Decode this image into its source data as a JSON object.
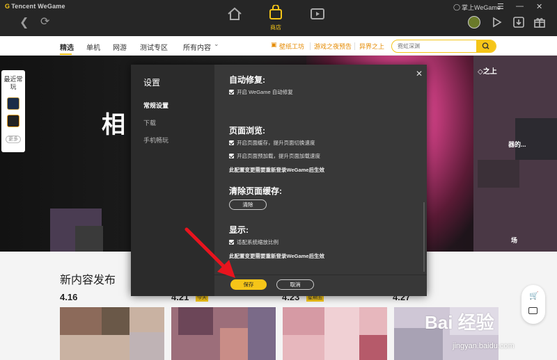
{
  "app": {
    "logo_text": "Tencent WeGame",
    "store_label": "商店",
    "user_label": "掌上WeGame"
  },
  "subnav": {
    "items": [
      "精选",
      "单机",
      "网游",
      "测试专区",
      "所有内容"
    ],
    "links": [
      "壁纸工坊",
      "游戏之夜预告",
      "异界之上"
    ],
    "search_placeholder": "霓虹深渊"
  },
  "hero": {
    "title_fragment": "相",
    "recent_label": "最近常玩",
    "more_label": "更多",
    "right_text_1": "◇之上",
    "right_text_2": "器的...",
    "right_text_3": "场"
  },
  "lower": {
    "section_title": "新内容发布",
    "dates": [
      "4.16",
      "4.21",
      "4.23",
      "4.27"
    ],
    "tags": [
      "今天",
      "星期五"
    ]
  },
  "settings": {
    "title": "设置",
    "side_items": [
      "常规设置",
      "下载",
      "手机畅玩"
    ],
    "auto_repair_heading": "自动修复:",
    "auto_repair_opt": "开启 WeGame 自动修复",
    "browse_heading": "页面浏览:",
    "browse_opt1": "开启页面缓存，提升页面切换速度",
    "browse_opt2": "开启页面预加载，提升页面加载速度",
    "browse_note": "此配置变更需要重新登录WeGame后生效",
    "clear_heading": "清除页面缓存:",
    "clear_button": "清除",
    "display_heading": "显示:",
    "display_opt": "适配系统缩放比例",
    "display_note": "此配置变更需要重新登录WeGame后生效",
    "save_button": "保存",
    "cancel_button": "取消"
  },
  "watermark": {
    "brand": "Bai 经验",
    "url": "jingyan.baidu.com"
  },
  "colors": {
    "accent": "#f5c518",
    "dialog_bg": "#383838",
    "dialog_side": "#2b2b2b",
    "arrow": "#e8141e"
  }
}
